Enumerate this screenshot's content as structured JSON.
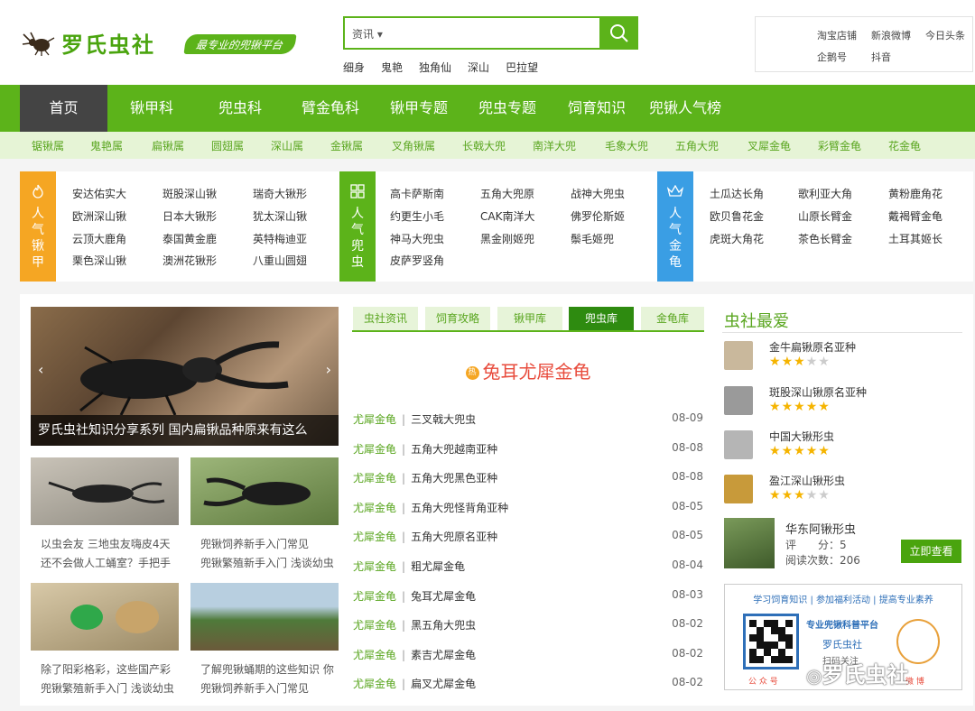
{
  "brand": {
    "logo_text": "罗氏虫社",
    "slogan": "最专业的兜锹平台"
  },
  "search": {
    "category": "资讯",
    "hot_terms": [
      "细身",
      "鬼艳",
      "独角仙",
      "深山",
      "巴拉望"
    ]
  },
  "toplinks": [
    "淘宝店铺",
    "新浪微博",
    "今日头条",
    "企鹅号",
    "抖音"
  ],
  "nav": [
    "首页",
    "锹甲科",
    "兜虫科",
    "臂金龟科",
    "锹甲专题",
    "兜虫专题",
    "饲育知识",
    "兜锹人气榜"
  ],
  "subnav": [
    "锯锹属",
    "鬼艳属",
    "扁锹属",
    "圆翅属",
    "深山属",
    "金锹属",
    "叉角锹属",
    "长戟大兜",
    "南洋大兜",
    "毛象大兜",
    "五角大兜",
    "叉犀金龟",
    "彩臂金龟",
    "花金龟"
  ],
  "hot_panel": {
    "stag": {
      "label": "人气锹甲",
      "items": [
        "安达佑实大",
        "斑股深山锹",
        "瑞奇大锹形",
        "欧洲深山锹",
        "日本大锹形",
        "犹太深山锹",
        "云顶大鹿角",
        "泰国黄金鹿",
        "英特梅迪亚",
        "栗色深山锹",
        "澳洲花锹形",
        "八重山圆翅"
      ]
    },
    "rhino": {
      "label": "人气兜虫",
      "items": [
        "高卡萨斯南",
        "五角大兜原",
        "战神大兜虫",
        "约更生小毛",
        "CAK南洋大",
        "佛罗伦斯姬",
        "神马大兜虫",
        "黑金刚姬兜",
        "鬃毛姬兜",
        "皮萨罗竖角"
      ]
    },
    "chafer": {
      "label": "人气金龟",
      "items": [
        "土瓜达长角",
        "歌利亚大角",
        "黄粉鹿角花",
        "欧贝鲁花金",
        "山原长臂金",
        "戴褐臂金龟",
        "虎斑大角花",
        "茶色长臂金",
        "土耳其姬长"
      ]
    }
  },
  "slide": {
    "caption": "罗氏虫社知识分享系列 国内扁锹品种原来有这么",
    "prev": "‹",
    "next": "›"
  },
  "thumbs": [
    {
      "line1": "以虫会友 三地虫友嗨皮4天",
      "line2": "还不会做人工蛹室？手把手"
    },
    {
      "line1": "兜锹饲养新手入门常见",
      "line2": "兜锹繁殖新手入门 浅谈幼虫"
    },
    {
      "line1": "除了阳彩格彩，这些国产彩",
      "line2": "兜锹繁殖新手入门 浅谈幼虫"
    },
    {
      "line1": "了解兜锹蛹期的这些知识 你",
      "line2": "兜锹饲养新手入门常见"
    }
  ],
  "tabs": [
    "虫社资讯",
    "饲育攻略",
    "锹甲库",
    "兜虫库",
    "金龟库"
  ],
  "featured": {
    "badge": "热",
    "title": "兔耳尤犀金龟"
  },
  "articles": [
    {
      "cat": "尤犀金龟",
      "title": "三叉戟大兜虫",
      "date": "08-09"
    },
    {
      "cat": "尤犀金龟",
      "title": "五角大兜越南亚种",
      "date": "08-08"
    },
    {
      "cat": "尤犀金龟",
      "title": "五角大兜黑色亚种",
      "date": "08-08"
    },
    {
      "cat": "尤犀金龟",
      "title": "五角大兜怪背角亚种",
      "date": "08-05"
    },
    {
      "cat": "尤犀金龟",
      "title": "五角大兜原名亚种",
      "date": "08-05"
    },
    {
      "cat": "尤犀金龟",
      "title": "粗尤犀金龟",
      "date": "08-04"
    },
    {
      "cat": "尤犀金龟",
      "title": "兔耳尤犀金龟",
      "date": "08-03"
    },
    {
      "cat": "尤犀金龟",
      "title": "黑五角大兜虫",
      "date": "08-02"
    },
    {
      "cat": "尤犀金龟",
      "title": "素吉尤犀金龟",
      "date": "08-02"
    },
    {
      "cat": "尤犀金龟",
      "title": "扁叉尤犀金龟",
      "date": "08-02"
    }
  ],
  "sidebar": {
    "title": "虫社最爱",
    "favorites": [
      {
        "name": "金牛扁锹原名亚种",
        "stars": 3
      },
      {
        "name": "斑股深山锹原名亚种",
        "stars": 5
      },
      {
        "name": "中国大锹形虫",
        "stars": 5
      },
      {
        "name": "盈江深山锹形虫",
        "stars": 3
      }
    ],
    "feature": {
      "name": "华东阿锹形虫",
      "rating_label": "评　　分：",
      "rating": "5",
      "reads_label": "阅读次数：",
      "reads": "206",
      "button": "立即查看"
    },
    "promo": {
      "links": [
        "学习饲育知识",
        "参加福利活动",
        "提高专业素养"
      ],
      "headline": "专业兜锹科普平台",
      "name": "罗氏虫社",
      "follow": "扫码关注",
      "qr1_label": "公 众 号",
      "qr2_label": "微 博"
    }
  },
  "watermark": "罗氏虫社"
}
